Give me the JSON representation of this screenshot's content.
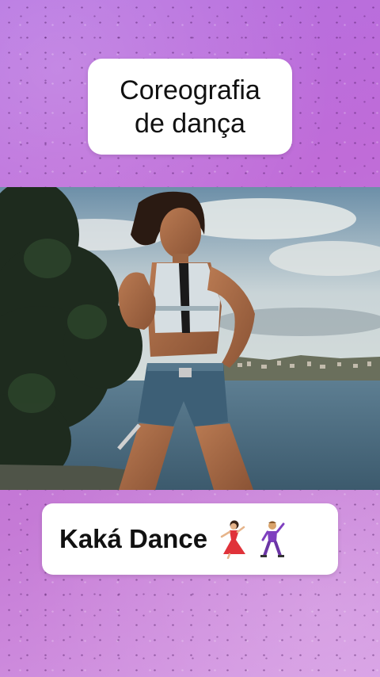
{
  "title_card": {
    "line1": "Coreografia",
    "line2": "de dança"
  },
  "bottom_card": {
    "text": "Kaká Dance",
    "icons": [
      "dancer-woman-icon",
      "dancer-man-icon"
    ]
  },
  "colors": {
    "background_start": "#b46fe0",
    "background_end": "#d59ae3",
    "card_bg": "#ffffff",
    "text": "#111111"
  }
}
